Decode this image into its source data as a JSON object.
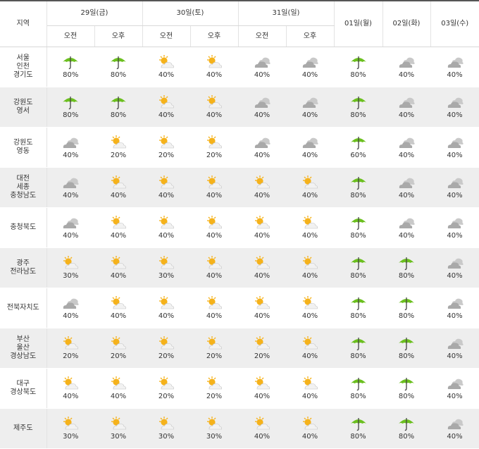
{
  "colors": {
    "umbrella": "#6bbf1f",
    "sun": "#f5b21b",
    "cloud": "#a9a9a9",
    "header_rule": "#555555",
    "row_alt_bg": "#eeeeee"
  },
  "icons": {
    "rain": "umbrella-icon",
    "sun": "sun-cloud-icon",
    "cloud": "cloud-icon"
  },
  "header": {
    "region": "지역",
    "days": [
      {
        "label": "29일(금)",
        "split": true
      },
      {
        "label": "30일(토)",
        "split": true
      },
      {
        "label": "31일(일)",
        "split": true
      },
      {
        "label": "01일(월)",
        "split": false
      },
      {
        "label": "02일(화)",
        "split": false
      },
      {
        "label": "03일(수)",
        "split": false
      }
    ],
    "am": "오전",
    "pm": "오후"
  },
  "rows": [
    {
      "region": [
        "서울",
        "인천",
        "경기도"
      ],
      "cells": [
        [
          "rain",
          "80%"
        ],
        [
          "rain",
          "80%"
        ],
        [
          "sun",
          "40%"
        ],
        [
          "sun",
          "40%"
        ],
        [
          "cloud",
          "40%"
        ],
        [
          "cloud",
          "40%"
        ],
        [
          "rain",
          "80%"
        ],
        [
          "cloud",
          "40%"
        ],
        [
          "cloud",
          "40%"
        ]
      ]
    },
    {
      "region": [
        "강원도",
        "영서"
      ],
      "cells": [
        [
          "rain",
          "80%"
        ],
        [
          "rain",
          "80%"
        ],
        [
          "sun",
          "40%"
        ],
        [
          "sun",
          "40%"
        ],
        [
          "cloud",
          "40%"
        ],
        [
          "cloud",
          "40%"
        ],
        [
          "rain",
          "80%"
        ],
        [
          "cloud",
          "40%"
        ],
        [
          "cloud",
          "40%"
        ]
      ]
    },
    {
      "region": [
        "강원도",
        "영동"
      ],
      "cells": [
        [
          "cloud",
          "40%"
        ],
        [
          "sun",
          "20%"
        ],
        [
          "sun",
          "20%"
        ],
        [
          "sun",
          "20%"
        ],
        [
          "cloud",
          "40%"
        ],
        [
          "cloud",
          "40%"
        ],
        [
          "rain",
          "60%"
        ],
        [
          "cloud",
          "40%"
        ],
        [
          "cloud",
          "40%"
        ]
      ]
    },
    {
      "region": [
        "대전",
        "세종",
        "충청남도"
      ],
      "cells": [
        [
          "cloud",
          "40%"
        ],
        [
          "sun",
          "40%"
        ],
        [
          "sun",
          "40%"
        ],
        [
          "sun",
          "40%"
        ],
        [
          "sun",
          "40%"
        ],
        [
          "sun",
          "40%"
        ],
        [
          "rain",
          "80%"
        ],
        [
          "cloud",
          "40%"
        ],
        [
          "cloud",
          "40%"
        ]
      ]
    },
    {
      "region": [
        "충청북도"
      ],
      "cells": [
        [
          "cloud",
          "40%"
        ],
        [
          "sun",
          "40%"
        ],
        [
          "sun",
          "40%"
        ],
        [
          "sun",
          "40%"
        ],
        [
          "sun",
          "40%"
        ],
        [
          "sun",
          "40%"
        ],
        [
          "rain",
          "80%"
        ],
        [
          "cloud",
          "40%"
        ],
        [
          "cloud",
          "40%"
        ]
      ]
    },
    {
      "region": [
        "광주",
        "전라남도"
      ],
      "cells": [
        [
          "sun",
          "30%"
        ],
        [
          "sun",
          "40%"
        ],
        [
          "sun",
          "30%"
        ],
        [
          "sun",
          "40%"
        ],
        [
          "sun",
          "40%"
        ],
        [
          "sun",
          "40%"
        ],
        [
          "rain",
          "80%"
        ],
        [
          "rain",
          "80%"
        ],
        [
          "cloud",
          "40%"
        ]
      ]
    },
    {
      "region": [
        "전북자치도"
      ],
      "cells": [
        [
          "cloud",
          "40%"
        ],
        [
          "sun",
          "40%"
        ],
        [
          "sun",
          "40%"
        ],
        [
          "sun",
          "40%"
        ],
        [
          "sun",
          "40%"
        ],
        [
          "sun",
          "40%"
        ],
        [
          "rain",
          "80%"
        ],
        [
          "rain",
          "80%"
        ],
        [
          "cloud",
          "40%"
        ]
      ]
    },
    {
      "region": [
        "부산",
        "울산",
        "경상남도"
      ],
      "cells": [
        [
          "sun",
          "20%"
        ],
        [
          "sun",
          "20%"
        ],
        [
          "sun",
          "20%"
        ],
        [
          "sun",
          "20%"
        ],
        [
          "sun",
          "20%"
        ],
        [
          "sun",
          "40%"
        ],
        [
          "rain",
          "80%"
        ],
        [
          "rain",
          "80%"
        ],
        [
          "cloud",
          "40%"
        ]
      ]
    },
    {
      "region": [
        "대구",
        "경상북도"
      ],
      "cells": [
        [
          "sun",
          "40%"
        ],
        [
          "sun",
          "40%"
        ],
        [
          "sun",
          "20%"
        ],
        [
          "sun",
          "20%"
        ],
        [
          "sun",
          "40%"
        ],
        [
          "sun",
          "40%"
        ],
        [
          "rain",
          "80%"
        ],
        [
          "rain",
          "80%"
        ],
        [
          "cloud",
          "40%"
        ]
      ]
    },
    {
      "region": [
        "제주도"
      ],
      "cells": [
        [
          "sun",
          "30%"
        ],
        [
          "sun",
          "30%"
        ],
        [
          "sun",
          "30%"
        ],
        [
          "sun",
          "30%"
        ],
        [
          "sun",
          "40%"
        ],
        [
          "sun",
          "40%"
        ],
        [
          "rain",
          "80%"
        ],
        [
          "rain",
          "80%"
        ],
        [
          "cloud",
          "40%"
        ]
      ]
    }
  ]
}
